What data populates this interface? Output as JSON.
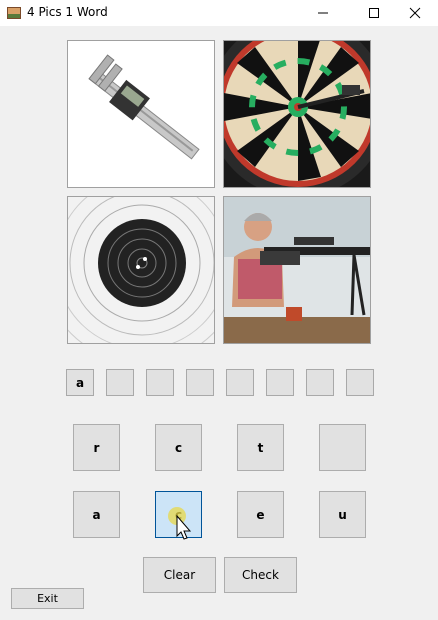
{
  "window": {
    "title": "4 Pics 1 Word",
    "icon": "app-picture-icon",
    "controls": [
      "minimize-icon",
      "maximize-icon",
      "close-icon"
    ]
  },
  "pictures": [
    {
      "subject": "vernier-caliper"
    },
    {
      "subject": "dartboard-with-dart"
    },
    {
      "subject": "shooting-target"
    },
    {
      "subject": "rifle-shooter"
    }
  ],
  "answer_slots": [
    "a",
    "",
    "",
    "",
    "",
    "",
    "",
    ""
  ],
  "letter_buttons": {
    "row1": [
      "r",
      "c",
      "t",
      ""
    ],
    "row2": [
      "a",
      "c",
      "e",
      "u"
    ]
  },
  "actions": {
    "clear_label": "Clear",
    "check_label": "Check",
    "exit_label": "Exit"
  },
  "colors": {
    "button_bg": "#e1e1e1",
    "button_hover_bg": "#cce4f7",
    "button_hover_border": "#005499",
    "window_bg": "#f0f0f0"
  }
}
